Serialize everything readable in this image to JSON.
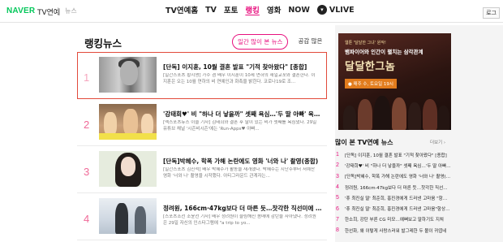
{
  "header": {
    "logo": "NAVER",
    "service": "TV연예",
    "separator": "|",
    "news_link": "뉴스",
    "nav": [
      {
        "label": "TV연예홈",
        "active": false
      },
      {
        "label": "TV",
        "active": false
      },
      {
        "label": "포토",
        "active": false
      },
      {
        "label": "랭킹",
        "active": true
      },
      {
        "label": "영화",
        "active": false
      },
      {
        "label": "NOW",
        "active": false
      }
    ],
    "vlive_label": "VLIVE",
    "vlive_chevron": "▾",
    "login_label": "로그"
  },
  "ranking": {
    "title": "랭킹뉴스",
    "sort_tabs": [
      {
        "label": "일간 많이 본 뉴스",
        "active": true
      },
      {
        "label": "공감 많은",
        "active": false
      }
    ],
    "items": [
      {
        "rank": "1",
        "headline": "[단독] 이지훈, 10월 결혼 발표 \"기적 찾아왔다\" [종합]",
        "summary": "[일간스포츠 황지영] 가수 겸 배우 이지훈이 10세 연하의 재일교포와 결혼한다. 이지훈은 오는 10월 연하의 비 연예인과 화촉을 밝힌다. 코로나19로 조...",
        "thumb": "bw-portrait",
        "highlighted": true
      },
      {
        "rank": "2",
        "headline": "'강태희♥' 비 \"하나 더 낳을까\" 셋째 욕심…'두 딸 아빠' 육아 스킬 (시…",
        "summary": "[엑스포츠뉴스 이슬 기자] 김태희와 결혼 후 딸이 있는 비가 셋째를 욕심냈다. 29일 유튜브 채널 '시즌비시즌'에는 'Run-Apps♥ 아빠...",
        "thumb": "tv-family",
        "highlighted": false
      },
      {
        "rank": "3",
        "headline": "[단독]박혜수, 학폭 가해 논란에도 영화 '너와 나' 촬영(종합)",
        "summary": "[일간스포츠 김진석] 배우 박혜수가 활동을 재개했다. 박혜수는 지난주부터 저예산 영화 '너와 나' 촬영을 시작했다. 아티그라운드 관계자는...",
        "thumb": "actress",
        "highlighted": false
      },
      {
        "rank": "4",
        "headline": "정려원, 166cm·47kg보다 더 마른 듯…찻각한 직선미에 김연경 \"Wo…",
        "summary": "[스포츠조선 조윤선 기자] 배우 정려원이 슬림해진 몸매에 감탄을 자아냈다. 정려원은 29일 자신의 인스타그램에 \"a trip to yo...",
        "thumb": "office",
        "highlighted": false
      }
    ]
  },
  "sidebar": {
    "ad": {
      "line1": "웹툰 '달달한 그녀' 원작!",
      "line2": "뱀파이어와 인간이 펼치는 삼각관계",
      "title": "달달한그놈",
      "schedule": "● 매주 수, 토요일 19시"
    },
    "most_viewed_title": "많이 본 TV연예 뉴스",
    "most_viewed_more": "더보기 ›",
    "most_viewed": [
      {
        "rank": "1",
        "text": "[단독] 이지훈, 10월 결혼 발표 \"기적 찾아왔다\" [종합]"
      },
      {
        "rank": "2",
        "text": "'강태희♥' 비 \"하나 더 낳을까\" 셋째 욕심…'두 딸 아빠' 육아"
      },
      {
        "rank": "3",
        "text": "[단독]박혜수, 학폭 가해 논란에도 영화 '너와 나' 촬영(종합)"
      },
      {
        "rank": "4",
        "text": "정려원, 166cm·47kg보다 더 마른 듯…찻각한 직선미에 김연경"
      },
      {
        "rank": "5",
        "text": "'휴 최진실 딸' 최준희, 홍진경에게 드러낸 고마움 \"항상 감…"
      },
      {
        "rank": "6",
        "text": "'휴 최진실 딸' 최준희, 홍진경에게 드러낸 고마움\"항상 감사…"
      },
      {
        "rank": "7",
        "text": "한소희, 강탄 부른 CG 미모…예뻐보고 말하기도 지쳐"
      },
      {
        "rank": "8",
        "text": "한선화, 왜 이렇게 사랑스러워 발그레한 두 볼이 귀엽네"
      }
    ]
  }
}
